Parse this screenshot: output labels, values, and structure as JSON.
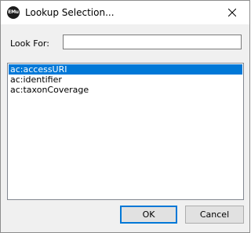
{
  "window": {
    "title": "Lookup Selection...",
    "app_icon_text": "EMu"
  },
  "search": {
    "label": "Look For:",
    "value": "",
    "placeholder": ""
  },
  "list": {
    "items": [
      {
        "label": "ac:accessURI",
        "selected": true
      },
      {
        "label": "ac:identifier",
        "selected": false
      },
      {
        "label": "ac:taxonCoverage",
        "selected": false
      }
    ]
  },
  "buttons": {
    "ok_label": "OK",
    "cancel_label": "Cancel"
  },
  "colors": {
    "selection": "#0078d7",
    "dialog_bg": "#f0f0f0"
  }
}
